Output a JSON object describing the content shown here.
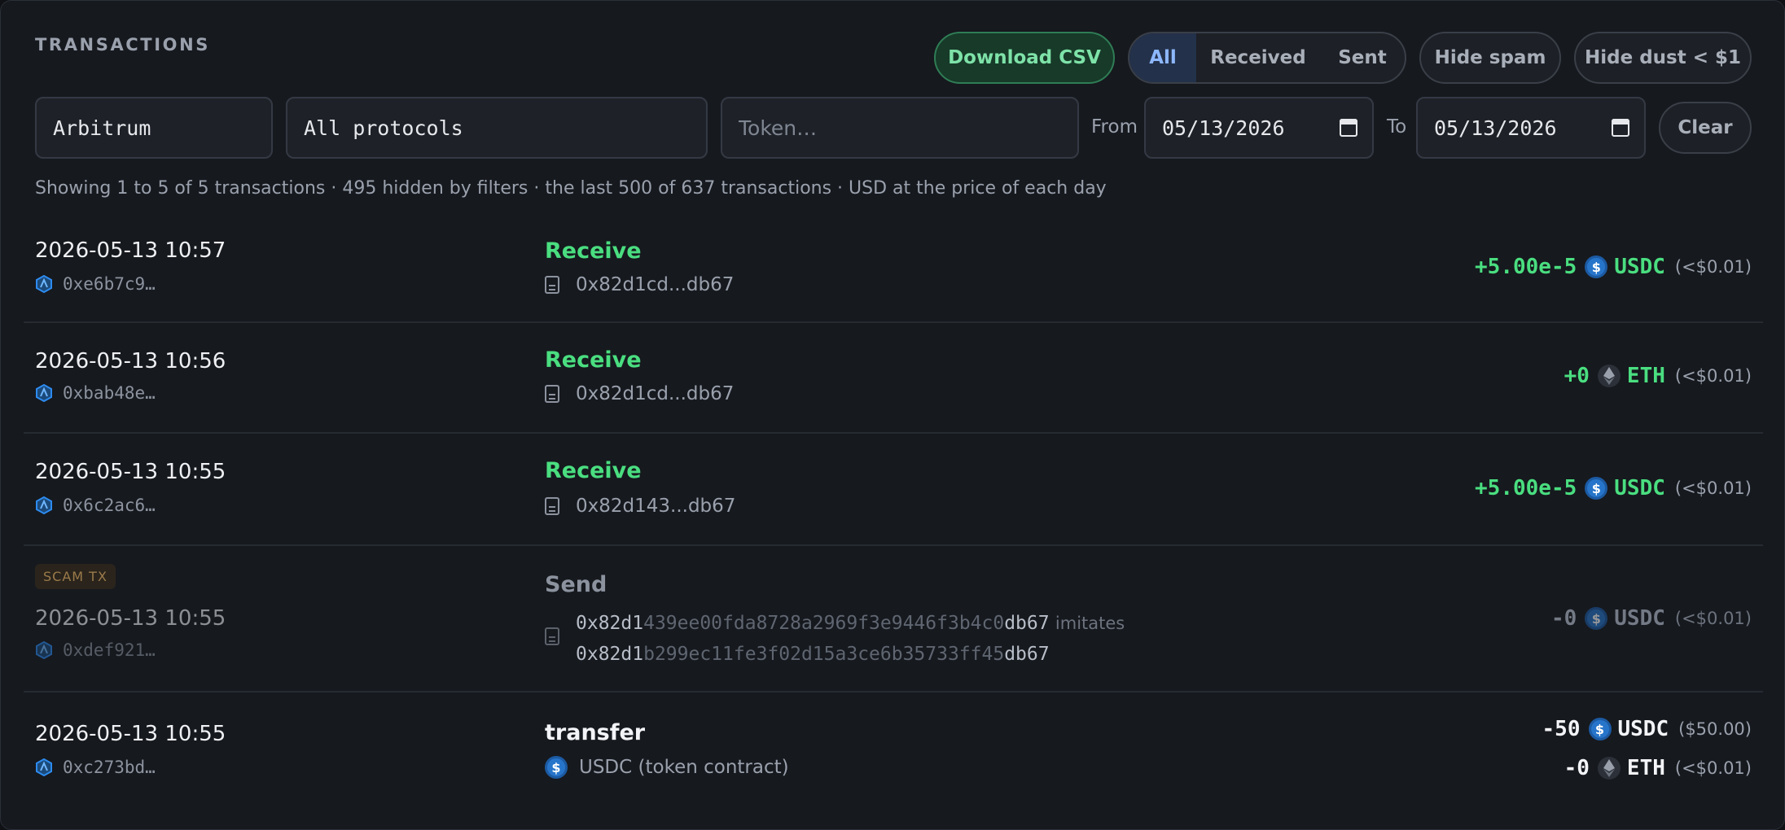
{
  "header": {
    "title": "TRANSACTIONS",
    "download_csv": "Download CSV",
    "filter_all": "All",
    "filter_received": "Received",
    "filter_sent": "Sent",
    "hide_spam": "Hide spam",
    "hide_dust": "Hide dust < $1"
  },
  "filters": {
    "network": "Arbitrum",
    "protocol": "All protocols",
    "token_placeholder": "Token…",
    "from_label": "From",
    "from_date": "05/13/2026",
    "to_label": "To",
    "to_date": "05/13/2026",
    "clear": "Clear"
  },
  "summary": "Showing 1 to 5 of 5 transactions · 495 hidden by filters · the last 500 of 637 transactions · USD at the price of each day",
  "rows": [
    {
      "date": "2026-05-13 10:57",
      "hash": "0xe6b7c9…",
      "kind": "Receive",
      "address": "0x82d1cd...db67",
      "amount": "+5.00e-5",
      "symbol": "USDC",
      "usd": "(<$0.01)"
    },
    {
      "date": "2026-05-13 10:56",
      "hash": "0xbab48e…",
      "kind": "Receive",
      "address": "0x82d1cd...db67",
      "amount": "+0",
      "symbol": "ETH",
      "usd": "(<$0.01)"
    },
    {
      "date": "2026-05-13 10:55",
      "hash": "0x6c2ac6…",
      "kind": "Receive",
      "address": "0x82d143...db67",
      "amount": "+5.00e-5",
      "symbol": "USDC",
      "usd": "(<$0.01)"
    },
    {
      "badge": "SCAM TX",
      "date": "2026-05-13 10:55",
      "hash": "0xdef921…",
      "kind": "Send",
      "addr1_prefix": "0x82d1",
      "addr1_mid": "439ee00fda8728a2969f3e9446f3b4c0",
      "addr1_suffix": "db67",
      "imitates": "imitates",
      "addr2_prefix": "0x82d1",
      "addr2_mid": "b299ec11fe3f02d15a3ce6b35733ff45",
      "addr2_suffix": "db67",
      "amount": "-0",
      "symbol": "USDC",
      "usd": "(<$0.01)"
    },
    {
      "date": "2026-05-13 10:55",
      "hash": "0xc273bd…",
      "kind": "transfer",
      "address": "USDC (token contract)",
      "amount": "-50",
      "symbol": "USDC",
      "usd": "($50.00)",
      "amount2": "-0",
      "symbol2": "ETH",
      "usd2": "(<$0.01)"
    }
  ]
}
